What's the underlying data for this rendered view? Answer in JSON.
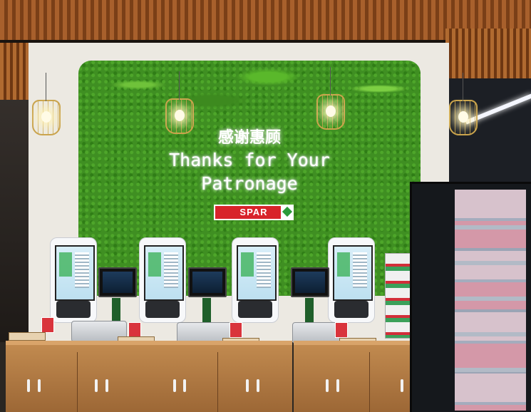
{
  "scene": {
    "sign_chinese": "感谢惠顾",
    "sign_english_line1": "Thanks for Your",
    "sign_english_line2": "Patronage",
    "brand_logo_text": "SPAR"
  },
  "colors": {
    "wall_green": "#3f8f22",
    "wood": "#b06a30",
    "spar_red": "#d8232a"
  }
}
